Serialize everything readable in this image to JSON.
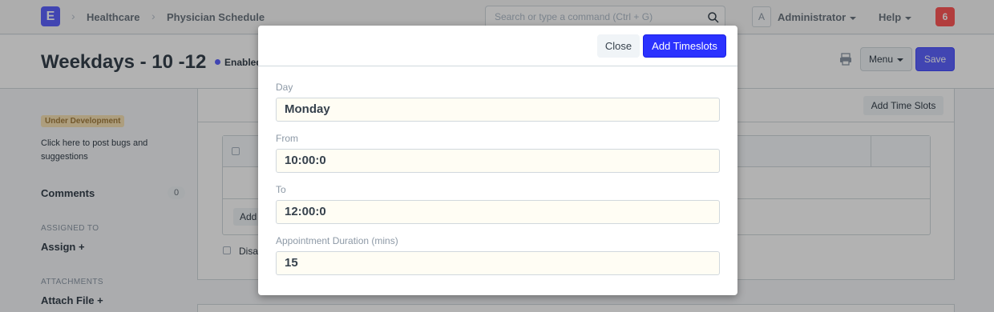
{
  "navbar": {
    "logo": "E",
    "breadcrumbs": [
      "Healthcare",
      "Physician Schedule"
    ],
    "search_placeholder": "Search or type a command (Ctrl + G)",
    "avatar_initial": "A",
    "user_label": "Administrator",
    "help_label": "Help",
    "notification_count": "6"
  },
  "page": {
    "title": "Weekdays - 10 -12",
    "status": "Enabled",
    "menu_label": "Menu",
    "save_label": "Save"
  },
  "sidebar": {
    "badge": "Under Development",
    "bug_text": "Click here to post bugs and suggestions",
    "comments_label": "Comments",
    "comments_count": "0",
    "assigned_heading": "ASSIGNED TO",
    "assign_label": "Assign +",
    "attachments_heading": "ATTACHMENTS",
    "attach_label": "Attach File +"
  },
  "form": {
    "add_time_slots_label": "Add Time Slots",
    "grid_add_label": "Add",
    "disabled_label": "Disa"
  },
  "modal": {
    "close_label": "Close",
    "primary_label": "Add Timeslots",
    "fields": [
      {
        "label": "Day",
        "value": "Monday"
      },
      {
        "label": "From",
        "value": "10:00:0"
      },
      {
        "label": "To",
        "value": "12:00:0"
      },
      {
        "label": "Appointment Duration (mins)",
        "value": "15"
      }
    ]
  },
  "colors": {
    "primary": "#5e64ff",
    "modal_primary": "#2b32ff",
    "notification": "#ff5858",
    "badge_bg": "#f8e2b5"
  }
}
